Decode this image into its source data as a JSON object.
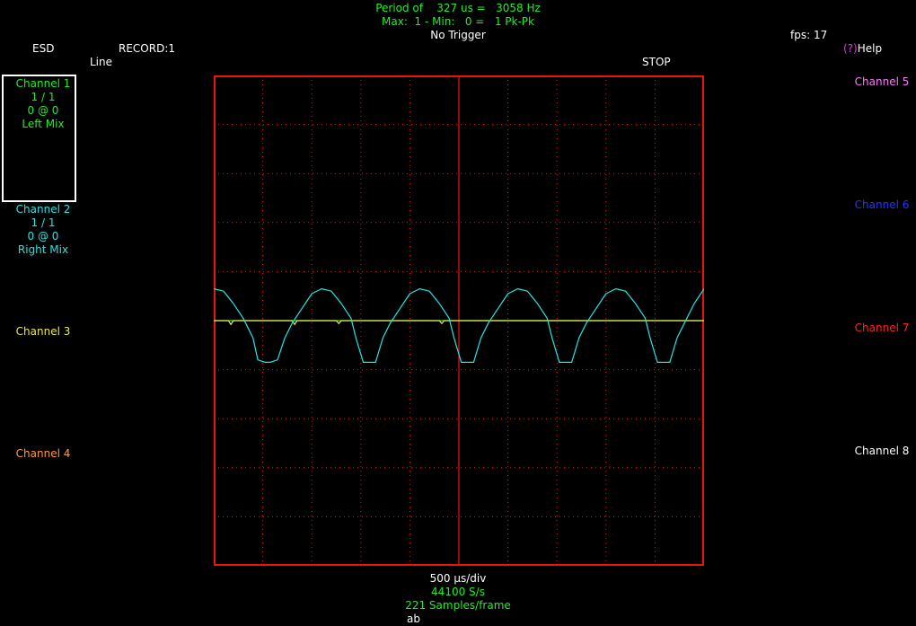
{
  "app": {
    "esd_label": "ESD",
    "record_label": "RECORD:1",
    "trigger_source": "Line",
    "run_state": "STOP",
    "fps": "fps: 17",
    "help": "(?)Help"
  },
  "measurements": {
    "period_line": "Period of    327 us =   3058 Hz",
    "maxmin_line": "Max:  1 - Min:   0 =   1 Pk-Pk",
    "trigger_status": "No Trigger"
  },
  "timebase": {
    "div": "500 µs/div",
    "rate": "44100 S/s",
    "samples": "221 Samples/frame",
    "input": "ab"
  },
  "channels_left": [
    {
      "name": "Channel 1",
      "scale": "1 / 1",
      "offset": "0 @ 0",
      "source": "Left Mix",
      "color": "#22ee22"
    },
    {
      "name": "Channel 2",
      "scale": "1 / 1",
      "offset": "0 @ 0",
      "source": "Right Mix",
      "color": "#22e6e6"
    },
    {
      "name": "Channel 3",
      "color": "#e8e84a"
    },
    {
      "name": "Channel 4",
      "color": "#ff9933"
    }
  ],
  "channels_right": [
    {
      "name": "Channel 5",
      "color": "#ff77ff"
    },
    {
      "name": "Channel 6",
      "color": "#2233ff"
    },
    {
      "name": "Channel 7",
      "color": "#ff2222"
    },
    {
      "name": "Channel 8",
      "color": "#ffffff"
    }
  ],
  "colors": {
    "graticule": "#ee1111",
    "text_green": "#22ee22",
    "help_accent": "#cc44cc",
    "trace_ch1": "#22ee22",
    "trace_ch2": "#22e6e6",
    "trace_ch3": "#e8e84a"
  },
  "chart_data": {
    "type": "line",
    "grid": true,
    "divisions": {
      "x": 10,
      "y": 10
    },
    "ylim": [
      -5,
      5
    ],
    "series": [
      {
        "name": "Channel 1",
        "color": "#22ee22",
        "x": [
          0,
          10
        ],
        "y": [
          0,
          0
        ]
      },
      {
        "name": "Channel 3",
        "color": "#e8e84a",
        "x": [
          0,
          0.3,
          0.35,
          0.4,
          1.6,
          1.65,
          1.7,
          2.5,
          2.55,
          2.6,
          4.6,
          4.65,
          4.7,
          10
        ],
        "y": [
          0,
          0,
          -0.08,
          0,
          0,
          -0.08,
          0,
          0,
          -0.06,
          0,
          0,
          -0.06,
          0,
          0
        ]
      },
      {
        "name": "Channel 2",
        "color": "#22e6e6",
        "x": [
          0,
          0.2,
          0.4,
          0.6,
          0.8,
          0.9,
          1.05,
          1.15,
          1.3,
          1.45,
          1.6,
          1.8,
          2.0,
          2.2,
          2.4,
          2.6,
          2.8,
          2.9,
          3.05,
          3.15,
          3.3,
          3.45,
          3.6,
          3.8,
          4.0,
          4.2,
          4.4,
          4.6,
          4.8,
          4.9,
          5.05,
          5.15,
          5.3,
          5.45,
          5.6,
          5.8,
          6.0,
          6.2,
          6.4,
          6.6,
          6.8,
          6.9,
          7.05,
          7.15,
          7.3,
          7.45,
          7.6,
          7.8,
          8.0,
          8.2,
          8.4,
          8.6,
          8.8,
          8.9,
          9.05,
          9.15,
          9.3,
          9.45,
          9.6,
          9.8,
          10.0
        ],
        "y": [
          0.65,
          0.6,
          0.35,
          0.05,
          -0.35,
          -0.8,
          -0.85,
          -0.85,
          -0.8,
          -0.35,
          -0.05,
          0.25,
          0.55,
          0.65,
          0.6,
          0.35,
          0.05,
          -0.35,
          -0.85,
          -0.85,
          -0.85,
          -0.35,
          -0.05,
          0.25,
          0.55,
          0.65,
          0.6,
          0.35,
          0.05,
          -0.35,
          -0.85,
          -0.85,
          -0.85,
          -0.35,
          -0.05,
          0.25,
          0.55,
          0.65,
          0.6,
          0.35,
          0.05,
          -0.35,
          -0.85,
          -0.85,
          -0.85,
          -0.35,
          -0.05,
          0.25,
          0.55,
          0.65,
          0.6,
          0.35,
          0.05,
          -0.35,
          -0.85,
          -0.85,
          -0.85,
          -0.35,
          -0.05,
          0.35,
          0.65
        ]
      }
    ]
  }
}
